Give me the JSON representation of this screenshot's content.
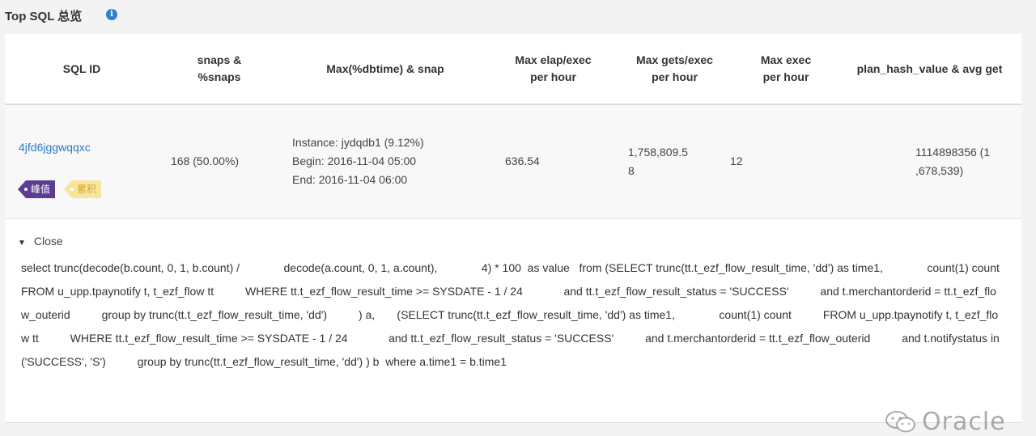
{
  "panel": {
    "title": "Top SQL 总览",
    "info_icon": "i"
  },
  "table": {
    "headers": {
      "sql_id": "SQL ID",
      "snaps_line1": "snaps &",
      "snaps_line2": "%snaps",
      "maxdbtime": "Max(%dbtime) & snap",
      "elap_line1": "Max elap/exec",
      "elap_line2": "per hour",
      "gets_line1": "Max gets/exec",
      "gets_line2": "per hour",
      "exec_line1": "Max exec",
      "exec_line2": "per hour",
      "plan": "plan_hash_value & avg get"
    },
    "rows": [
      {
        "sql_id": "4jfd6jggwqqxc",
        "tags": {
          "peak": "峰值",
          "cumulative": "累积"
        },
        "snaps": "168 (50.00%)",
        "instance": "Instance: jydqdb1 (9.12%)",
        "begin": "Begin: 2016-11-04 05:00",
        "end": "End: 2016-11-04 06:00",
        "max_elap": "636.54",
        "max_gets_line1": "1,758,809.5",
        "max_gets_line2": "8",
        "max_exec": "12",
        "plan_line1": "1114898356 (1",
        "plan_line2": ",678,539)"
      }
    ]
  },
  "detail": {
    "toggle_label": "Close",
    "sql_text": "select trunc(decode(b.count, 0, 1, b.count) /              decode(a.count, 0, 1, a.count),              4) * 100  as value   from (SELECT trunc(tt.t_ezf_flow_result_time, 'dd') as time1,              count(1) count          FROM u_upp.tpaynotify t, t_ezf_flow tt          WHERE tt.t_ezf_flow_result_time >= SYSDATE - 1 / 24             and tt.t_ezf_flow_result_status = 'SUCCESS'          and t.merchantorderid = tt.t_ezf_flow_outerid          group by trunc(tt.t_ezf_flow_result_time, 'dd')          ) a,       (SELECT trunc(tt.t_ezf_flow_result_time, 'dd') as time1,              count(1) count          FROM u_upp.tpaynotify t, t_ezf_flow tt          WHERE tt.t_ezf_flow_result_time >= SYSDATE - 1 / 24             and tt.t_ezf_flow_result_status = 'SUCCESS'          and t.merchantorderid = tt.t_ezf_flow_outerid          and t.notifystatus in ('SUCCESS', 'S')          group by trunc(tt.t_ezf_flow_result_time, 'dd') ) b  where a.time1 = b.time1"
  },
  "watermark": {
    "text": "Oracle",
    "icon": "wechat-icon"
  },
  "colors": {
    "link": "#2b7bc4",
    "tag_peak": "#5b3d91",
    "tag_cumulative": "#f7e59b",
    "info": "#2f7fd1"
  }
}
